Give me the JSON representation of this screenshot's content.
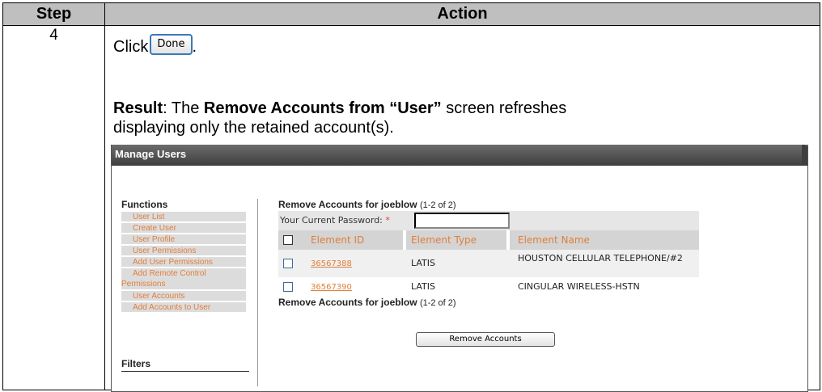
{
  "table": {
    "step_header": "Step",
    "action_header": "Action",
    "step_number": "4"
  },
  "instruction": {
    "click_text": "Click",
    "done_button": "Done",
    "period": "."
  },
  "result": {
    "label": "Result",
    "text_before": ": The ",
    "screen_name": "Remove Accounts from “User”",
    "text_after_line1": " screen refreshes",
    "line2": "displaying only the retained account(s)."
  },
  "manage_users": {
    "title": "Manage Users",
    "functions_heading": "Functions",
    "functions": [
      "User List",
      "Create User",
      "User Profile",
      "User Permissions",
      "Add User Permissions",
      "Add Remote Control Permissions",
      "User Accounts",
      "Add Accounts to User"
    ],
    "filters_heading": "Filters",
    "panel_heading": "Remove Accounts for joeblow",
    "panel_count": "(1-2 of 2)",
    "password_label": "Your Current Password:",
    "required_marker": "*",
    "password_value": "",
    "columns": {
      "id": "Element ID",
      "type": "Element Type",
      "name": "Element Name"
    },
    "rows": [
      {
        "id": "36567388",
        "type": "LATIS",
        "name": "HOUSTON CELLULAR TELEPHONE/#2"
      },
      {
        "id": "36567390",
        "type": "LATIS",
        "name": "CINGULAR WIRELESS-HSTN"
      }
    ],
    "footer_heading": "Remove Accounts for joeblow",
    "footer_count": "(1-2 of 2)",
    "remove_button": "Remove Accounts"
  }
}
